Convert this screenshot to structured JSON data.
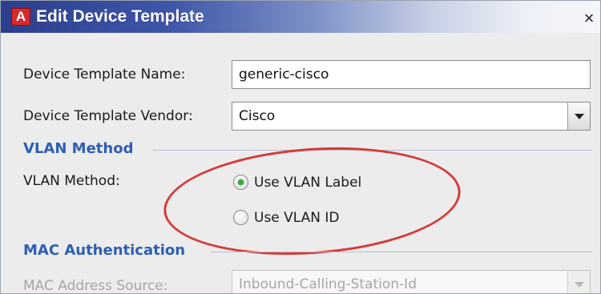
{
  "window": {
    "title": "Edit Device Template",
    "app_icon_letter": "A",
    "close_glyph": "×"
  },
  "form": {
    "name_label": "Device Template Name:",
    "name_value": "generic-cisco",
    "vendor_label": "Device Template Vendor:",
    "vendor_value": "Cisco"
  },
  "vlan_section": {
    "title": "VLAN Method",
    "method_label": "VLAN Method:",
    "options": [
      {
        "label": "Use VLAN Label",
        "selected": true
      },
      {
        "label": "Use VLAN ID",
        "selected": false
      }
    ]
  },
  "mac_section": {
    "title": "MAC Authentication",
    "source_label": "MAC Address Source:",
    "source_value": "Inbound-Calling-Station-Id"
  },
  "colors": {
    "section_title": "#2d5db5",
    "annotation": "#d63a3a",
    "radio_selected": "#3aa63a"
  }
}
